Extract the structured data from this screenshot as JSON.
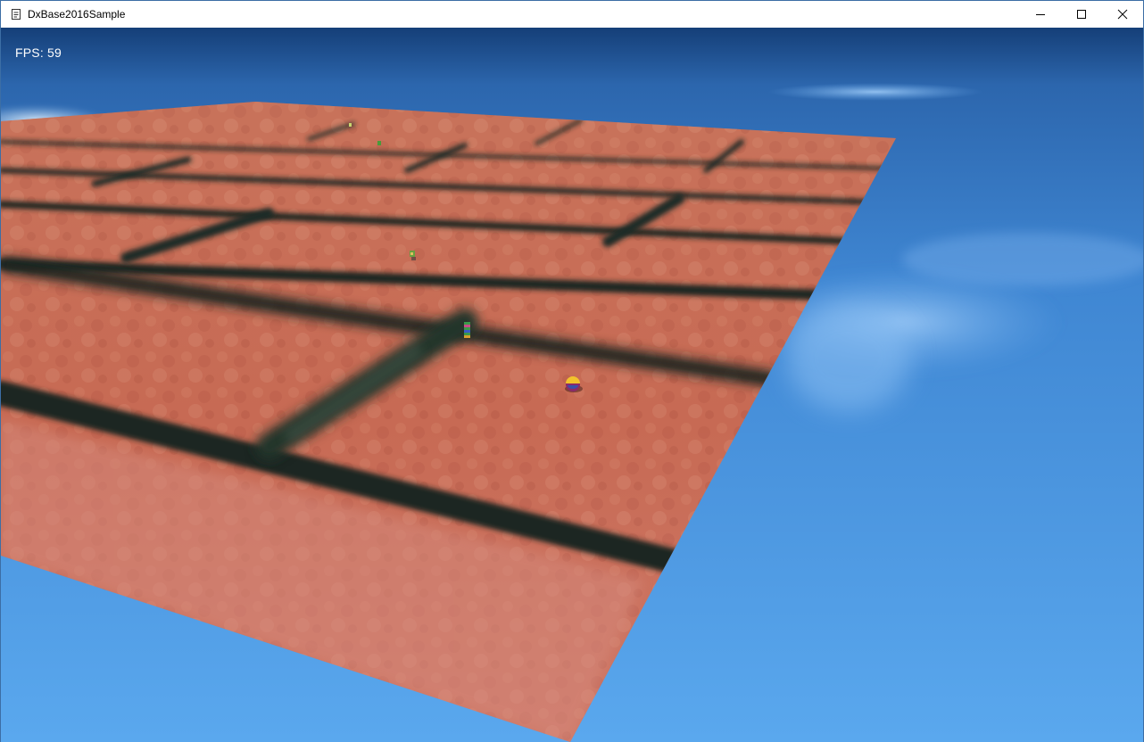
{
  "window": {
    "title": "DxBase2016Sample",
    "icon": "document-icon",
    "controls": {
      "minimize_icon": "minimize-icon",
      "maximize_icon": "maximize-icon",
      "close_icon": "close-icon"
    }
  },
  "hud": {
    "fps_text": "FPS: 59"
  },
  "scene": {
    "sky_color_top": "#1a4a8a",
    "sky_color_mid": "#3f88d6",
    "sky_color_bottom": "#5aa6ec",
    "ground_texture": "red-brick",
    "brick_color": "#c8705a",
    "mortar_color": "#1e2a22",
    "objects": [
      {
        "name": "player-ball",
        "colors": [
          "#f2c22c",
          "#8a2a6a",
          "#3a4fa8"
        ]
      },
      {
        "name": "enemy-figure"
      },
      {
        "name": "enemy-figure"
      },
      {
        "name": "enemy-figure"
      },
      {
        "name": "enemy-figure"
      }
    ]
  }
}
